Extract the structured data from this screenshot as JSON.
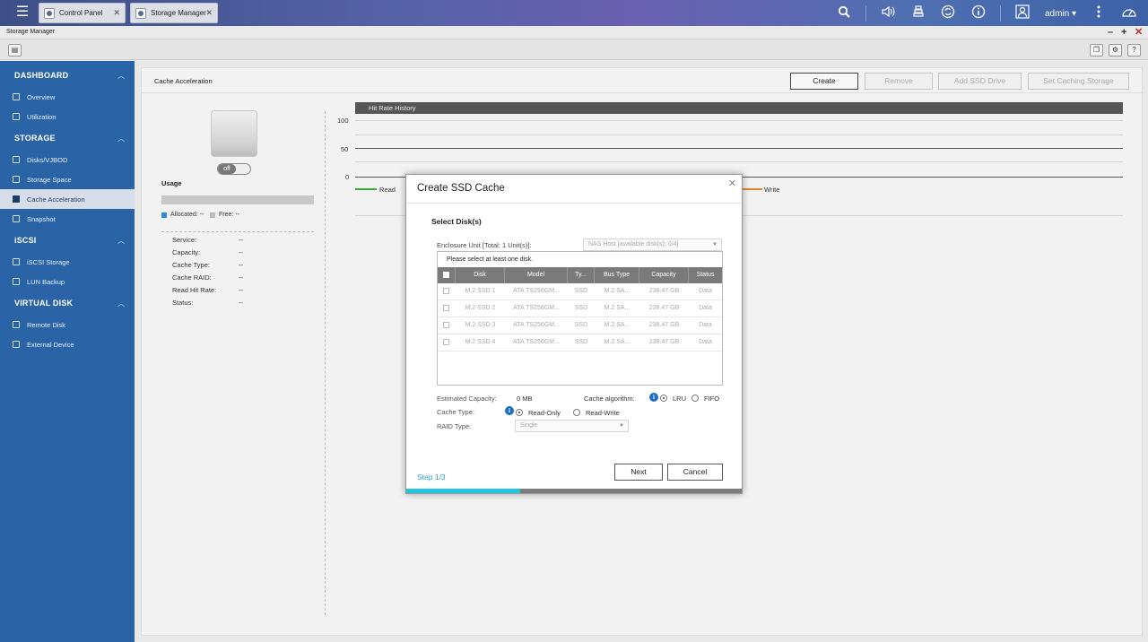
{
  "taskbar": {
    "tabs": [
      {
        "label": "Control Panel",
        "close": "✕"
      },
      {
        "label": "Storage Manager",
        "close": "✕"
      }
    ],
    "user": "admin ▾",
    "icons": [
      "menu-icon",
      "search-icon",
      "volume-icon",
      "tasks-icon",
      "sync-icon",
      "info-icon",
      "user-icon",
      "more-icon",
      "dashboard-icon"
    ]
  },
  "window": {
    "title": "Storage Manager",
    "controls": {
      "minimize": "–",
      "maximize": "+",
      "close": "✕"
    }
  },
  "sidebar": {
    "sections": [
      {
        "title": "DASHBOARD",
        "items": [
          "Overview",
          "Utilization"
        ]
      },
      {
        "title": "STORAGE",
        "items": [
          "Disks/VJBOD",
          "Storage Space",
          "Cache Acceleration",
          "Snapshot"
        ]
      },
      {
        "title": "iSCSI",
        "items": [
          "iSCSI Storage",
          "LUN Backup"
        ]
      },
      {
        "title": "VIRTUAL DISK",
        "items": [
          "Remote Disk",
          "External Device"
        ]
      }
    ],
    "active_item": "Cache Acceleration"
  },
  "main": {
    "title": "Cache Acceleration",
    "buttons": {
      "create": "Create",
      "remove": "Remove",
      "add_ssd": "Add SSD Drive",
      "set_caching": "Set Caching Storage"
    },
    "toggle": "off",
    "usage_label": "Usage",
    "legend": {
      "allocated": "Allocated: --",
      "free": "Free: --"
    },
    "info": [
      {
        "label": "Service:",
        "value": "--"
      },
      {
        "label": "Capacity:",
        "value": "--"
      },
      {
        "label": "Cache Type:",
        "value": "--"
      },
      {
        "label": "Cache RAID:",
        "value": "--"
      },
      {
        "label": "Read Hit Rate:",
        "value": "--"
      },
      {
        "label": "Status:",
        "value": "--"
      }
    ],
    "chart": {
      "title": "Hit Rate History",
      "yticks": [
        "100",
        "50",
        "0"
      ],
      "legend_read": "Read",
      "legend_write": "Write",
      "colors": {
        "read": "#3aa63a",
        "write": "#e8832a"
      }
    }
  },
  "modal": {
    "title": "Create SSD Cache",
    "close": "✕",
    "heading": "Select Disk(s)",
    "enclosure_label": "Enclosure Unit [Total: 1 Unit(s)]:",
    "enclosure_value": "NAS Host [available disk(s): 0/4]",
    "note": "Please select at least one disk.",
    "columns": [
      "Disk",
      "Model",
      "Ty...",
      "Bus Type",
      "Capacity",
      "Status"
    ],
    "rows": [
      [
        "M.2 SSD 1",
        "ATA TS256GM...",
        "SSD",
        "M.2 SA...",
        "238.47 GB",
        "Data"
      ],
      [
        "M.2 SSD 2",
        "ATA TS256GM...",
        "SSD",
        "M.2 SA...",
        "238.47 GB",
        "Data"
      ],
      [
        "M.2 SSD 3",
        "ATA TS256GM...",
        "SSD",
        "M.2 SA...",
        "238.47 GB",
        "Data"
      ],
      [
        "M.2 SSD 4",
        "ATA TS256GM...",
        "SSD",
        "M.2 SA...",
        "238.47 GB",
        "Data"
      ]
    ],
    "estimated_capacity_label": "Estimated Capacity:",
    "estimated_capacity_value": "0 MB",
    "cache_algorithm_label": "Cache algorithm:",
    "algo_lru": "LRU",
    "algo_fifo": "FIFO",
    "cache_type_label": "Cache Type:",
    "type_read_only": "Read-Only",
    "type_read_write": "Read-Write",
    "raid_type_label": "RAID Type:",
    "raid_type_value": "Single",
    "step": "Step 1/3",
    "next": "Next",
    "cancel": "Cancel",
    "progress_percent": 34
  }
}
